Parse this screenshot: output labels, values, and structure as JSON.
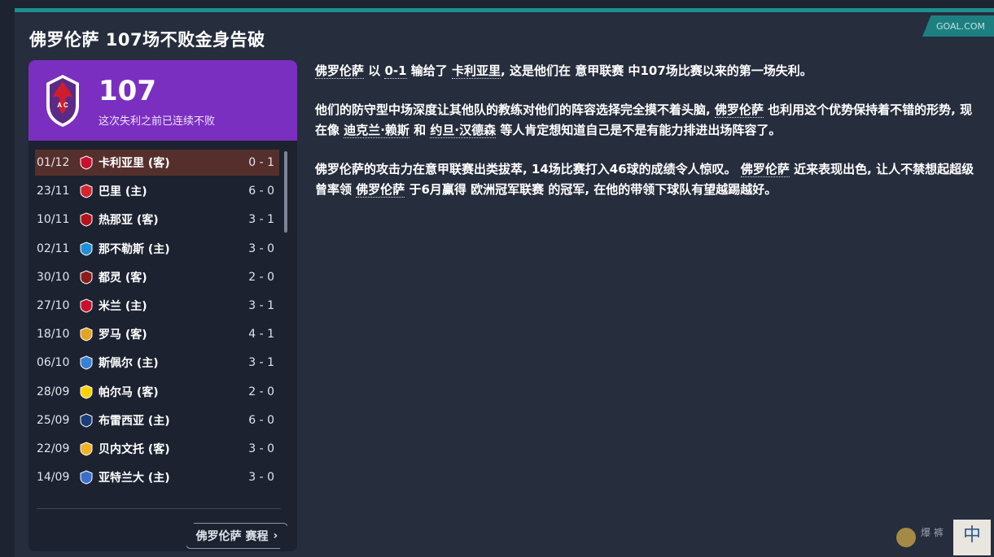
{
  "page": {
    "title": "佛罗伦萨 107场不败金身告破",
    "source": "GOAL.COM"
  },
  "streak": {
    "count": "107",
    "caption": "这次失利之前已连续不败"
  },
  "results": [
    {
      "date": "01/12",
      "team": "卡利亚里 (客)",
      "score": "0 - 1",
      "crest_color": "#c8102e",
      "selected": true
    },
    {
      "date": "23/11",
      "team": "巴里 (主)",
      "score": "6 - 0",
      "crest_color": "#d22630"
    },
    {
      "date": "10/11",
      "team": "热那亚 (客)",
      "score": "3 - 1",
      "crest_color": "#b5121b"
    },
    {
      "date": "02/11",
      "team": "那不勒斯 (主)",
      "score": "3 - 0",
      "crest_color": "#1f8fd6"
    },
    {
      "date": "30/10",
      "team": "都灵 (客)",
      "score": "2 - 0",
      "crest_color": "#8a1c1c"
    },
    {
      "date": "27/10",
      "team": "米兰 (主)",
      "score": "3 - 1",
      "crest_color": "#c8102e"
    },
    {
      "date": "18/10",
      "team": "罗马 (客)",
      "score": "4 - 1",
      "crest_color": "#e3a323"
    },
    {
      "date": "06/10",
      "team": "斯佩尔 (主)",
      "score": "3 - 1",
      "crest_color": "#3a7fd5"
    },
    {
      "date": "28/09",
      "team": "帕尔马 (客)",
      "score": "2 - 0",
      "crest_color": "#ffd100"
    },
    {
      "date": "25/09",
      "team": "布雷西亚 (主)",
      "score": "6 - 0",
      "crest_color": "#1b3d7a"
    },
    {
      "date": "22/09",
      "team": "贝内文托 (客)",
      "score": "3 - 0",
      "crest_color": "#f0b323"
    },
    {
      "date": "14/09",
      "team": "亚特兰大 (主)",
      "score": "3 - 0",
      "crest_color": "#3b6fcf"
    }
  ],
  "fixtures_button": "佛罗伦萨 赛程",
  "article": {
    "p1": [
      "佛罗伦萨",
      " 以 ",
      "0-1",
      " 输给了 ",
      "卡利亚里",
      ", 这是他们在 ",
      "意甲联赛",
      " 中107场比赛以来的第一场失利。"
    ],
    "p2": [
      "他们的防守型中场深度让其他队的教练对他们的阵容选择完全摸不着头脑, ",
      "佛罗伦萨",
      " 也利用这个优势保持着不错的形势, 现在像 ",
      "迪克兰·赖斯",
      " 和 ",
      "约旦·汉德森",
      " 等人肯定想知道自己是不是有能力排进出场阵容了。"
    ],
    "p3": [
      "佛罗伦萨",
      "的攻击力在意甲联赛出类拔萃, 14场比赛打入46球的成绩令人惊叹。 ",
      "佛罗伦萨",
      " 近来表现出色, 让人不禁想起超级 ",
      "曾率领 ",
      "佛罗伦萨",
      " 于6月赢得 ",
      "欧洲冠军联赛",
      " 的冠军, 在他的带领下球队有望越踢越好。"
    ]
  },
  "watermark": "中"
}
